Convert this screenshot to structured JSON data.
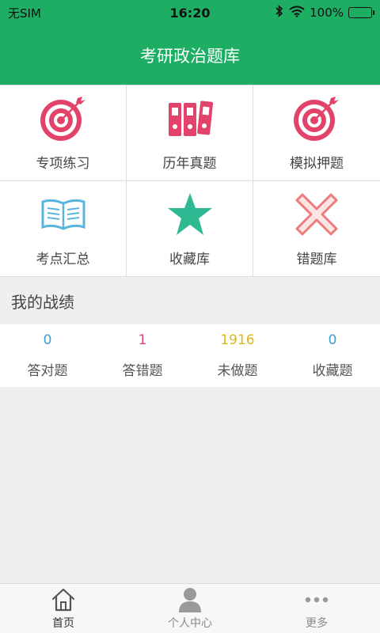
{
  "status": {
    "carrier": "无SIM",
    "time": "16:20",
    "battery": "100%"
  },
  "header": {
    "title": "考研政治题库"
  },
  "grid": [
    {
      "label": "专项练习",
      "icon": "target-icon"
    },
    {
      "label": "历年真题",
      "icon": "binders-icon"
    },
    {
      "label": "模拟押题",
      "icon": "target-icon"
    },
    {
      "label": "考点汇总",
      "icon": "book-icon"
    },
    {
      "label": "收藏库",
      "icon": "star-icon"
    },
    {
      "label": "错题库",
      "icon": "cross-icon"
    }
  ],
  "record": {
    "title": "我的战绩",
    "stats": [
      {
        "value": "0",
        "label": "答对题",
        "color": "#3e9fcf"
      },
      {
        "value": "1",
        "label": "答错题",
        "color": "#e2436a"
      },
      {
        "value": "1916",
        "label": "未做题",
        "color": "#e0b716"
      },
      {
        "value": "0",
        "label": "收藏题",
        "color": "#3e9fcf"
      }
    ]
  },
  "tabs": [
    {
      "label": "首页",
      "icon": "home-icon",
      "active": true
    },
    {
      "label": "个人中心",
      "icon": "person-icon",
      "active": false
    },
    {
      "label": "更多",
      "icon": "more-icon",
      "active": false
    }
  ],
  "colors": {
    "brand": "#1dae64",
    "target": "#e2436a",
    "star": "#2fb992",
    "cross": "#ef7c7c",
    "book": "#5ab4dd"
  }
}
